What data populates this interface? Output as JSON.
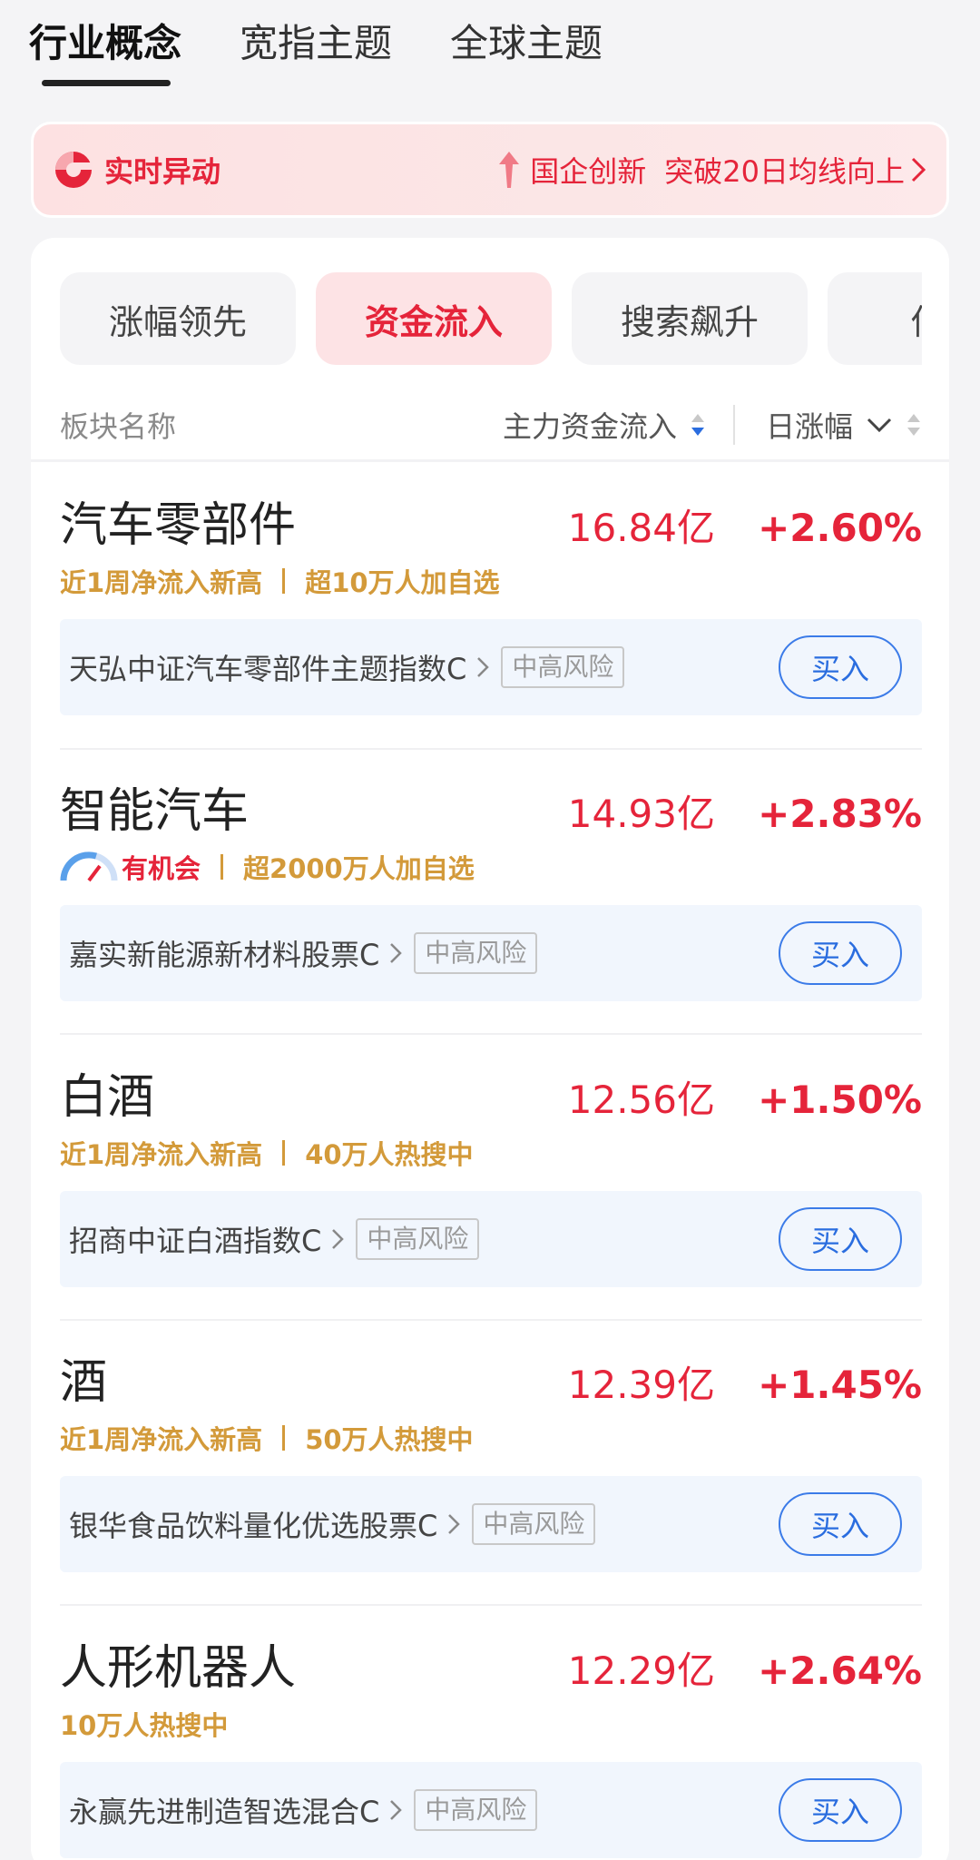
{
  "top_tabs": [
    {
      "label": "行业概念",
      "active": true
    },
    {
      "label": "宽指主题",
      "active": false
    },
    {
      "label": "全球主题",
      "active": false
    }
  ],
  "realtime": {
    "label": "实时异动",
    "sector": "国企创新",
    "event": "突破20日均线向上"
  },
  "filters": [
    {
      "label": "涨幅领先",
      "active": false
    },
    {
      "label": "资金流入",
      "active": true
    },
    {
      "label": "搜索飙升",
      "active": false
    },
    {
      "label": "估值",
      "active": false
    }
  ],
  "columns": {
    "name": "板块名称",
    "flow": "主力资金流入",
    "change": "日涨幅"
  },
  "items": [
    {
      "name": "汽车零部件",
      "flow": "16.84亿",
      "change": "+2.60%",
      "tag1": "近1周净流入新高",
      "tag2": "超10万人加自选",
      "fund": "天弘中证汽车零部件主题指数C",
      "risk": "中高风险",
      "buy": "买入"
    },
    {
      "name": "智能汽车",
      "flow": "14.93亿",
      "change": "+2.83%",
      "tag1": "有机会",
      "tag2": "超2000万人加自选",
      "fund": "嘉实新能源新材料股票C",
      "risk": "中高风险",
      "buy": "买入"
    },
    {
      "name": "白酒",
      "flow": "12.56亿",
      "change": "+1.50%",
      "tag1": "近1周净流入新高",
      "tag2": "40万人热搜中",
      "fund": "招商中证白酒指数C",
      "risk": "中高风险",
      "buy": "买入"
    },
    {
      "name": "酒",
      "flow": "12.39亿",
      "change": "+1.45%",
      "tag1": "近1周净流入新高",
      "tag2": "50万人热搜中",
      "fund": "银华食品饮料量化优选股票C",
      "risk": "中高风险",
      "buy": "买入"
    },
    {
      "name": "人形机器人",
      "flow": "12.29亿",
      "change": "+2.64%",
      "tag1": "10万人热搜中",
      "fund": "永赢先进制造智选混合C",
      "risk": "中高风险",
      "buy": "买入"
    }
  ],
  "colors": {
    "accent_red": "#e5243a",
    "tag_gold": "#d39a3a",
    "buy_blue": "#3b7be8"
  }
}
